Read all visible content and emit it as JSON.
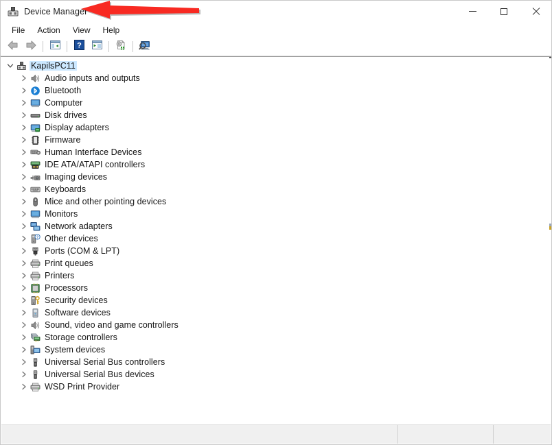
{
  "window": {
    "title": "Device Manager",
    "icon": "device-manager-icon",
    "controls": {
      "minimize": "Minimize",
      "maximize": "Maximize",
      "close": "Close"
    }
  },
  "menubar": {
    "items": [
      {
        "label": "File"
      },
      {
        "label": "Action"
      },
      {
        "label": "View"
      },
      {
        "label": "Help"
      }
    ]
  },
  "toolbar": {
    "buttons": [
      {
        "name": "back-button",
        "icon": "back-arrow-icon"
      },
      {
        "name": "forward-button",
        "icon": "forward-arrow-icon"
      },
      {
        "name": "show-hide-console-tree-button",
        "icon": "console-tree-icon"
      },
      {
        "name": "help-button",
        "icon": "help-question-icon"
      },
      {
        "name": "properties-button",
        "icon": "properties-window-icon"
      },
      {
        "name": "update-driver-button",
        "icon": "update-driver-icon"
      },
      {
        "name": "scan-for-hardware-changes-button",
        "icon": "scan-hardware-icon"
      }
    ]
  },
  "tree": {
    "root": {
      "label": "KapilsPC11",
      "icon": "computer-root-icon",
      "expanded": true,
      "selected": true
    },
    "items": [
      {
        "label": "Audio inputs and outputs",
        "icon": "speaker-icon"
      },
      {
        "label": "Bluetooth",
        "icon": "bluetooth-icon"
      },
      {
        "label": "Computer",
        "icon": "monitor-icon"
      },
      {
        "label": "Disk drives",
        "icon": "disk-drive-icon"
      },
      {
        "label": "Display adapters",
        "icon": "display-adapter-icon"
      },
      {
        "label": "Firmware",
        "icon": "firmware-chip-icon"
      },
      {
        "label": "Human Interface Devices",
        "icon": "hid-gamepad-icon"
      },
      {
        "label": "IDE ATA/ATAPI controllers",
        "icon": "ide-controller-icon"
      },
      {
        "label": "Imaging devices",
        "icon": "camera-icon"
      },
      {
        "label": "Keyboards",
        "icon": "keyboard-icon"
      },
      {
        "label": "Mice and other pointing devices",
        "icon": "mouse-icon"
      },
      {
        "label": "Monitors",
        "icon": "monitor-icon"
      },
      {
        "label": "Network adapters",
        "icon": "network-adapter-icon"
      },
      {
        "label": "Other devices",
        "icon": "unknown-device-icon"
      },
      {
        "label": "Ports (COM & LPT)",
        "icon": "port-connector-icon"
      },
      {
        "label": "Print queues",
        "icon": "printer-icon"
      },
      {
        "label": "Printers",
        "icon": "printer-icon"
      },
      {
        "label": "Processors",
        "icon": "processor-chip-icon"
      },
      {
        "label": "Security devices",
        "icon": "security-key-icon"
      },
      {
        "label": "Software devices",
        "icon": "software-device-icon"
      },
      {
        "label": "Sound, video and game controllers",
        "icon": "speaker-icon"
      },
      {
        "label": "Storage controllers",
        "icon": "storage-controller-icon"
      },
      {
        "label": "System devices",
        "icon": "system-device-icon"
      },
      {
        "label": "Universal Serial Bus controllers",
        "icon": "usb-icon"
      },
      {
        "label": "Universal Serial Bus devices",
        "icon": "usb-icon"
      },
      {
        "label": "WSD Print Provider",
        "icon": "printer-icon"
      }
    ]
  },
  "statusbar": {
    "main_text": "",
    "panel2_text": "",
    "panel3_text": ""
  },
  "annotation": {
    "type": "arrow",
    "direction": "left",
    "color": "#F82A22",
    "points_to": "Device Manager"
  },
  "colors": {
    "selection": "#cce8ff",
    "window_bg": "#ffffff",
    "statusbar_bg": "#f0f0f0",
    "text": "#151515",
    "annotation_red": "#F82A22"
  }
}
